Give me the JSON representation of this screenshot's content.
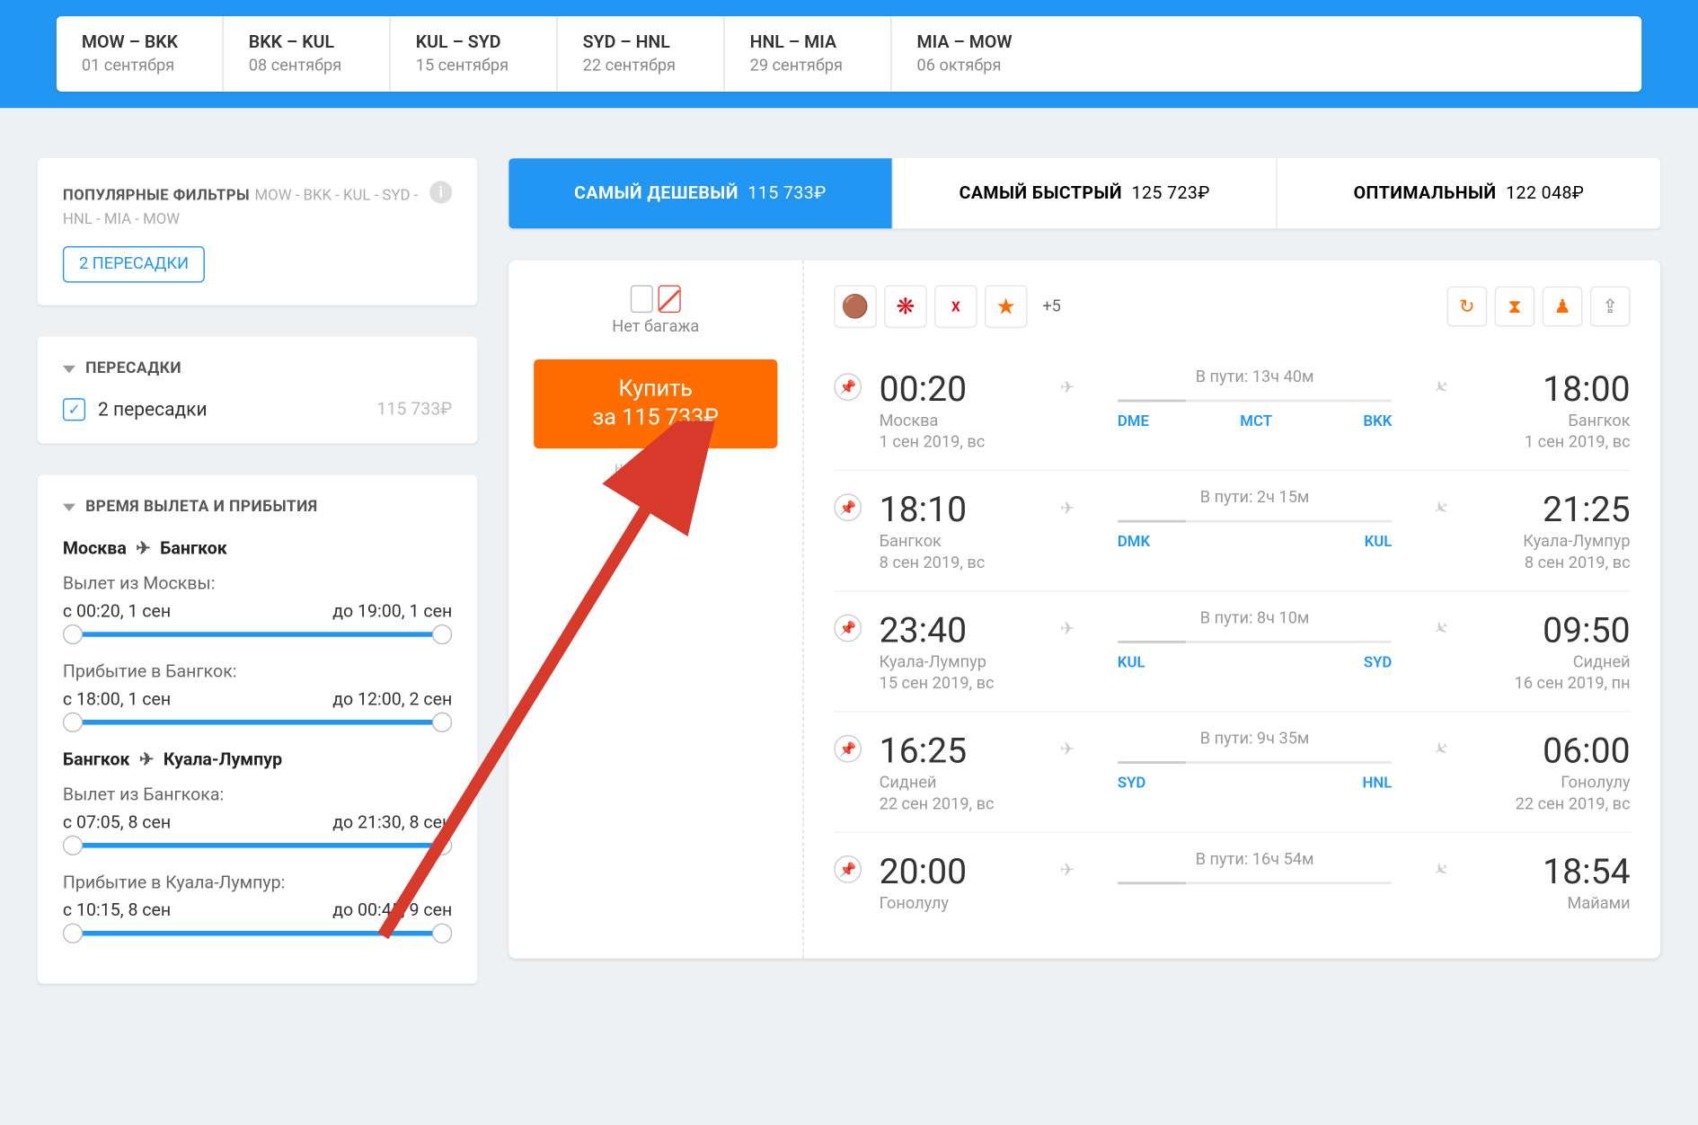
{
  "routes": [
    {
      "code": "MOW – BKK",
      "date": "01 сентября"
    },
    {
      "code": "BKK – KUL",
      "date": "08 сентября"
    },
    {
      "code": "KUL – SYD",
      "date": "15 сентября"
    },
    {
      "code": "SYD – HNL",
      "date": "22 сентября"
    },
    {
      "code": "HNL – MIA",
      "date": "29 сентября"
    },
    {
      "code": "MIA – MOW",
      "date": "06 октября"
    }
  ],
  "filters": {
    "popular_title": "ПОПУЛЯРНЫЕ ФИЛЬТРЫ",
    "popular_sub": "MOW - BKK - KUL - SYD - HNL - MIA - MOW",
    "chip": "2 ПЕРЕСАДКИ",
    "transfers_title": "ПЕРЕСАДКИ",
    "transfers_option": "2 пересадки",
    "transfers_price": "115 733₽",
    "times_title": "ВРЕМЯ ВЫЛЕТА И ПРИБЫТИЯ",
    "legs": [
      {
        "title_from": "Москва",
        "title_to": "Бангкок",
        "dep_label": "Вылет из Москвы:",
        "dep_from": "с 00:20, 1 сен",
        "dep_to": "до 19:00, 1 сен",
        "arr_label": "Прибытие в Бангкок:",
        "arr_from": "с 18:00, 1 сен",
        "arr_to": "до 12:00, 2 сен"
      },
      {
        "title_from": "Бангкок",
        "title_to": "Куала-Лумпур",
        "dep_label": "Вылет из Бангкока:",
        "dep_from": "с 07:05, 8 сен",
        "dep_to": "до 21:30, 8 сен",
        "arr_label": "Прибытие в Куала-Лумпур:",
        "arr_from": "с 10:15, 8 сен",
        "arr_to": "до 00:45, 9 сен"
      }
    ]
  },
  "sort": {
    "cheapest": "САМЫЙ ДЕШЕВЫЙ",
    "cheapest_price": "115 733₽",
    "fastest": "САМЫЙ БЫСТРЫЙ",
    "fastest_price": "125 723₽",
    "optimal": "ОПТИМАЛЬНЫЙ",
    "optimal_price": "122 048₽"
  },
  "ticket": {
    "baggage": "Нет багажа",
    "buy_label": "Купить",
    "buy_price": "за 115 733₽",
    "buy_sub": "на Kiwi.com",
    "plus_more": "+5",
    "segments": [
      {
        "dep_time": "00:20",
        "dep_city": "Москва",
        "dep_date": "1 сен 2019, вс",
        "dur": "В пути: 13ч 40м",
        "codes": [
          "DME",
          "MCT",
          "BKK"
        ],
        "arr_time": "18:00",
        "arr_city": "Бангкок",
        "arr_date": "1 сен 2019, вс"
      },
      {
        "dep_time": "18:10",
        "dep_city": "Бангкок",
        "dep_date": "8 сен 2019, вс",
        "dur": "В пути: 2ч 15м",
        "codes": [
          "DMK",
          "",
          "KUL"
        ],
        "arr_time": "21:25",
        "arr_city": "Куала-Лумпур",
        "arr_date": "8 сен 2019, вс"
      },
      {
        "dep_time": "23:40",
        "dep_city": "Куала-Лумпур",
        "dep_date": "15 сен 2019, вс",
        "dur": "В пути: 8ч 10м",
        "codes": [
          "KUL",
          "",
          "SYD"
        ],
        "arr_time": "09:50",
        "arr_city": "Сидней",
        "arr_date": "16 сен 2019, пн"
      },
      {
        "dep_time": "16:25",
        "dep_city": "Сидней",
        "dep_date": "22 сен 2019, вс",
        "dur": "В пути: 9ч 35м",
        "codes": [
          "SYD",
          "",
          "HNL"
        ],
        "arr_time": "06:00",
        "arr_city": "Гонолулу",
        "arr_date": "22 сен 2019, вс"
      },
      {
        "dep_time": "20:00",
        "dep_city": "Гонолулу",
        "dep_date": "",
        "dur": "В пути: 16ч 54м",
        "codes": [
          "",
          "",
          ""
        ],
        "arr_time": "18:54",
        "arr_city": "Майами",
        "arr_date": ""
      }
    ]
  }
}
